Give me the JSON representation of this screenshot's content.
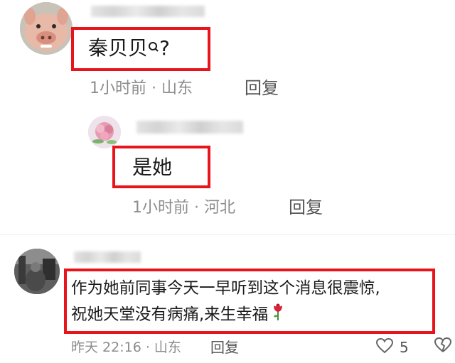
{
  "comments": [
    {
      "text": "秦贝贝",
      "suffix": "?",
      "meta": "1小时前 · 山东",
      "reply_label": "回复"
    },
    {
      "text": "是她",
      "meta": "1小时前 · 河北",
      "reply_label": "回复"
    },
    {
      "line1": "作为她前同事今天一早听到这个消息很震惊,",
      "line2": "祝她天堂没有病痛,来生幸福",
      "meta": "昨天 22:16 · 山东",
      "reply_label": "回复",
      "like_count": "5"
    }
  ],
  "colors": {
    "highlight": "#e8141c",
    "meta": "#8c8c8c"
  },
  "icons": [
    "search-icon",
    "rose-icon",
    "heart-icon",
    "broken-heart-icon"
  ]
}
